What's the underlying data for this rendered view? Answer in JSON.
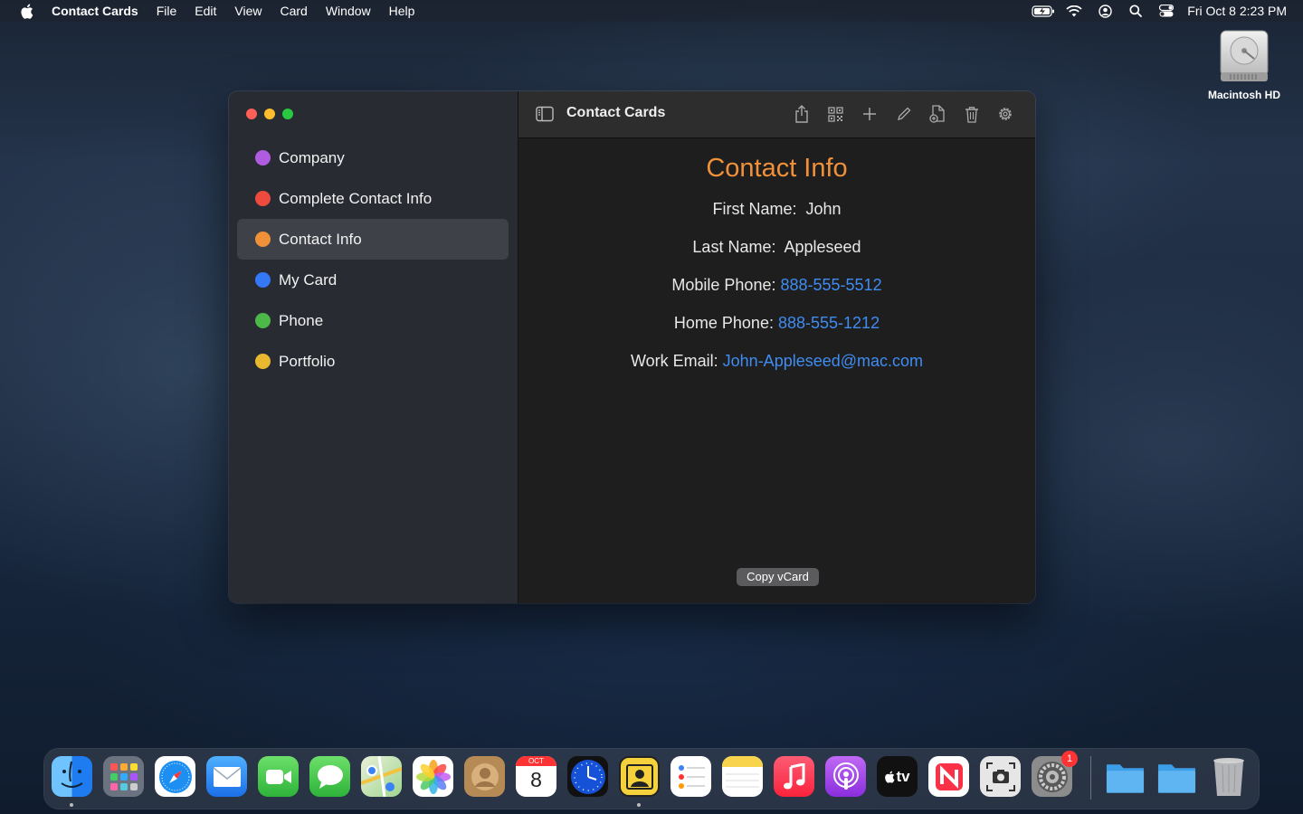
{
  "menubar": {
    "app_name": "Contact Cards",
    "menus": [
      "File",
      "Edit",
      "View",
      "Card",
      "Window",
      "Help"
    ],
    "clock": "Fri Oct 8  2:23 PM",
    "status_icons": [
      "battery-charging-icon",
      "wifi-icon",
      "user-icon",
      "spotlight-search-icon",
      "control-center-icon"
    ]
  },
  "desktop": {
    "drive_label": "Macintosh HD"
  },
  "window": {
    "title": "Contact Cards",
    "sidebar": {
      "items": [
        {
          "label": "Company",
          "color": "#b05ce0"
        },
        {
          "label": "Complete Contact Info",
          "color": "#ee4b3f"
        },
        {
          "label": "Contact Info",
          "color": "#f0913a",
          "selected": true
        },
        {
          "label": "My Card",
          "color": "#3478f6"
        },
        {
          "label": "Phone",
          "color": "#4cb848"
        },
        {
          "label": "Portfolio",
          "color": "#e8b92e"
        }
      ]
    },
    "toolbar_icons": [
      "share-icon",
      "qr-code-icon",
      "plus-icon",
      "pencil-icon",
      "new-document-icon",
      "trash-icon",
      "gear-icon"
    ],
    "content": {
      "heading": "Contact Info",
      "first_name_label": "First Name:",
      "first_name": "John",
      "last_name_label": "Last Name:",
      "last_name": "Appleseed",
      "mobile_label": "Mobile Phone:",
      "mobile": "888-555-5512",
      "home_label": "Home Phone:",
      "home": "888-555-1212",
      "email_label": "Work Email:",
      "email": "John-Appleseed@mac.com",
      "copy_button": "Copy vCard"
    }
  },
  "dock": {
    "items": [
      "finder-icon",
      "launchpad-icon",
      "safari-icon",
      "mail-icon",
      "facetime-icon",
      "messages-icon",
      "maps-icon",
      "photos-icon",
      "contacts-icon",
      "calendar-icon",
      "clock-icon",
      "contact-cards-icon",
      "reminders-icon",
      "notes-icon",
      "music-icon",
      "podcasts-icon",
      "apple-tv-icon",
      "news-icon",
      "screenshot-icon",
      "system-preferences-icon",
      "folder-icon",
      "folder-icon",
      "trash-icon"
    ],
    "calendar_month": "OCT",
    "calendar_day": "8",
    "tv_label": "tv",
    "sysprefs_badge": "1"
  }
}
